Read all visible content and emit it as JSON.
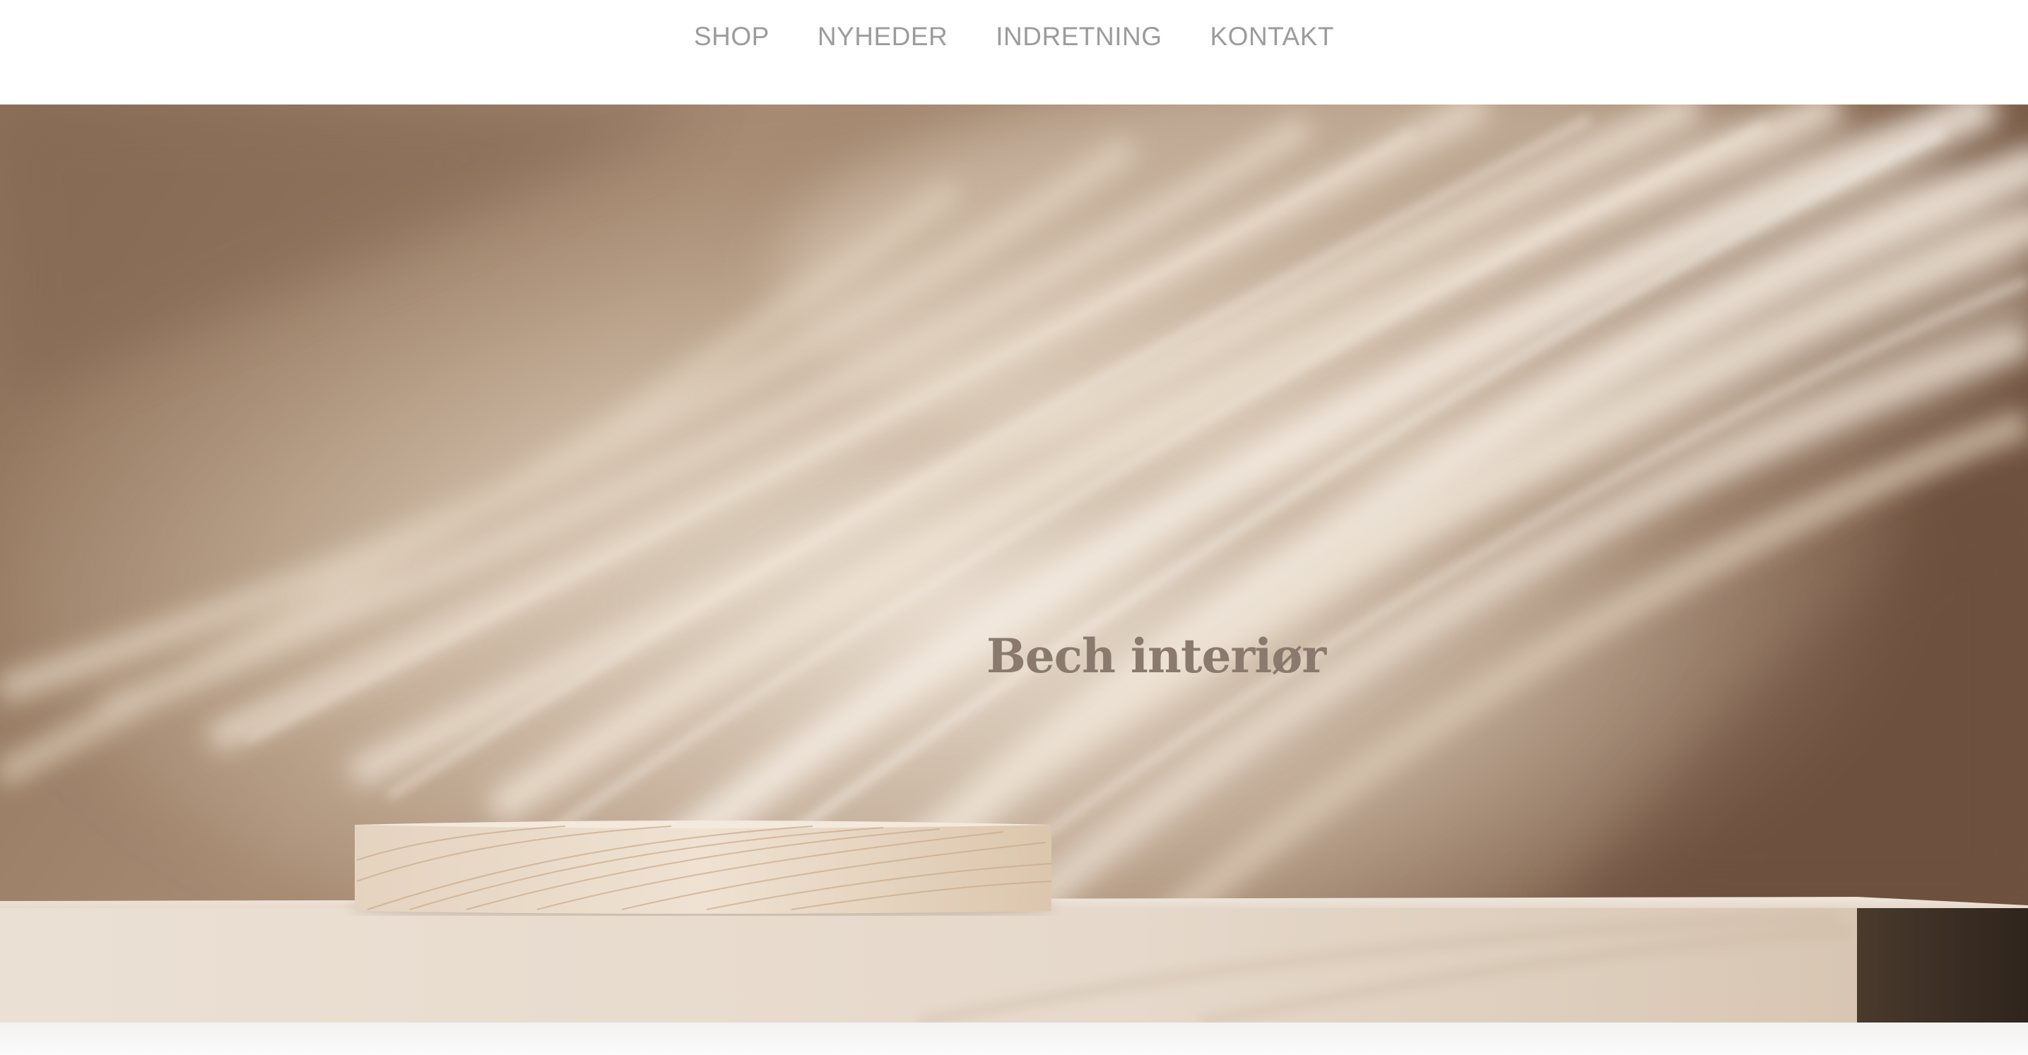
{
  "nav": {
    "items": [
      {
        "label": "SHOP"
      },
      {
        "label": "NYHEDER"
      },
      {
        "label": "INDRETNING"
      },
      {
        "label": "KONTAKT"
      }
    ]
  },
  "hero": {
    "title": "Bech interiør",
    "image": "beige-wall-palm-shadow-wooden-podium"
  },
  "colors": {
    "nav_text": "#9c9c9c",
    "hero_title": "#8a7a6e",
    "wall_dark": "#7b5f4a",
    "wall_light": "#e8dccd",
    "shelf": "#e6dbcf"
  }
}
